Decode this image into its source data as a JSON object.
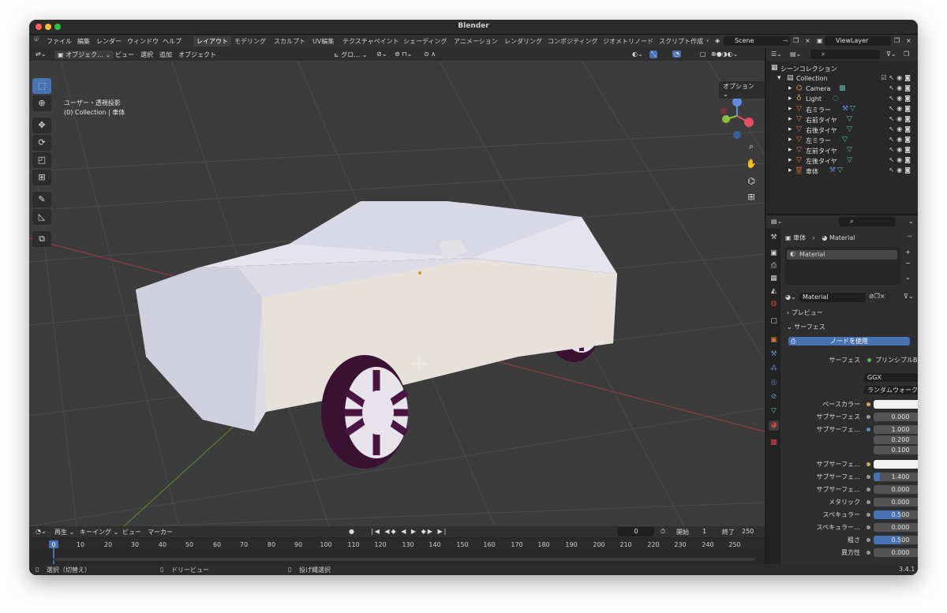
{
  "window": {
    "title": "Blender",
    "version": "3.4.1"
  },
  "menu": [
    "ファイル",
    "編集",
    "レンダー",
    "ウィンドウ",
    "ヘルプ"
  ],
  "workspaces": [
    "レイアウト",
    "モデリング",
    "スカルプト",
    "UV編集",
    "テクスチャペイント",
    "シェーディング",
    "アニメーション",
    "レンダリング",
    "コンポジティング",
    "ジオメトリノード",
    "スクリプト作成"
  ],
  "scene": {
    "name": "Scene",
    "view_layer": "ViewLayer"
  },
  "viewport": {
    "mode": "オブジェク…",
    "menus": [
      "ビュー",
      "選択",
      "追加",
      "オブジェクト"
    ],
    "transform": "グロ…",
    "view_name": "ユーザー・透視投影",
    "collection_info": "(0) Collection | 車体",
    "options": "オプション"
  },
  "outliner": {
    "root": "シーンコレクション",
    "collection": "Collection",
    "items": [
      "Camera",
      "Light",
      "右ミラー",
      "右前タイヤ",
      "右後タイヤ",
      "左ミラー",
      "左前タイヤ",
      "左後タイヤ",
      "車体"
    ]
  },
  "properties": {
    "object": "車体",
    "material": "Material",
    "slot": "Material",
    "material_field": "Material",
    "panels": {
      "preview": "プレビュー",
      "surface": "サーフェス"
    },
    "use_nodes": "ノードを使用",
    "surface_label": "サーフェス",
    "surface_value": "プリンシプルBSDF",
    "distribution": "GGX",
    "sss_method": "ランダムウォーク",
    "rows": [
      {
        "label": "ベースカラー",
        "value": "",
        "kind": "color"
      },
      {
        "label": "サブサーフェス",
        "value": "0.000"
      },
      {
        "label": "サブサーフェ…",
        "value": "1.000"
      },
      {
        "label": "",
        "value": "0.200"
      },
      {
        "label": "",
        "value": "0.100"
      },
      {
        "label": "サブサーフェ…",
        "value": "",
        "kind": "color"
      },
      {
        "label": "サブサーフェ…",
        "value": "1.400"
      },
      {
        "label": "サブサーフェ…",
        "value": "0.000"
      },
      {
        "label": "メタリック",
        "value": "0.000"
      },
      {
        "label": "スペキュラー",
        "value": "0.500",
        "fill": 0.5
      },
      {
        "label": "スペキュラー…",
        "value": "0.000"
      },
      {
        "label": "粗さ",
        "value": "0.500",
        "fill": 0.5
      },
      {
        "label": "異方性",
        "value": "0.000"
      }
    ]
  },
  "timeline": {
    "menus": [
      "再生",
      "キーイング",
      "ビュー",
      "マーカー"
    ],
    "current": "0",
    "start_label": "開始",
    "start": "1",
    "end_label": "終了",
    "end": "250",
    "frames": [
      "0",
      "10",
      "20",
      "30",
      "40",
      "50",
      "60",
      "70",
      "80",
      "90",
      "100",
      "110",
      "120",
      "130",
      "140",
      "150",
      "160",
      "170",
      "180",
      "190",
      "200",
      "210",
      "220",
      "230",
      "240",
      "250"
    ]
  },
  "status": [
    "選択（切替え）",
    "ドリービュー",
    "投げ縄選択"
  ],
  "colors": {
    "accent": "#4772b3",
    "tire": "#4a1540",
    "body": "#e6e4ea"
  }
}
